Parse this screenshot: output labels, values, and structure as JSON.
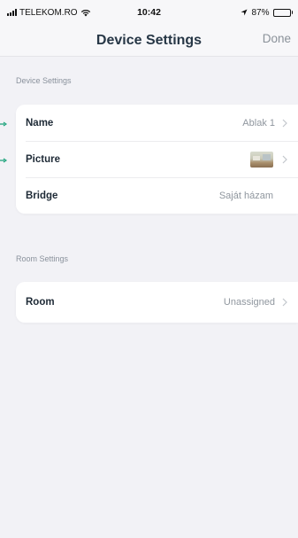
{
  "status_bar": {
    "carrier": "TELEKOM.RO",
    "time": "10:42",
    "battery": "87%",
    "battery_level": 0.87
  },
  "nav": {
    "title": "Device Settings",
    "done_label": "Done"
  },
  "device_settings": {
    "header": "Device Settings",
    "rows": [
      {
        "label": "Name",
        "value": "Ablak 1",
        "icon": "chevron-right-icon"
      },
      {
        "label": "Picture",
        "icon": "chevron-right-icon",
        "thumbnail": "room-thumbnail"
      },
      {
        "label": "Bridge",
        "value": "Saját házam"
      }
    ]
  },
  "room_settings": {
    "header": "Room Settings",
    "rows": [
      {
        "label": "Room",
        "value": "Unassigned",
        "icon": "chevron-right-icon"
      }
    ]
  },
  "colors": {
    "background": "#f2f2f6",
    "card": "#ffffff",
    "label": "#1e2a36",
    "secondary": "#8f969e",
    "marker": "#1aa37a"
  }
}
